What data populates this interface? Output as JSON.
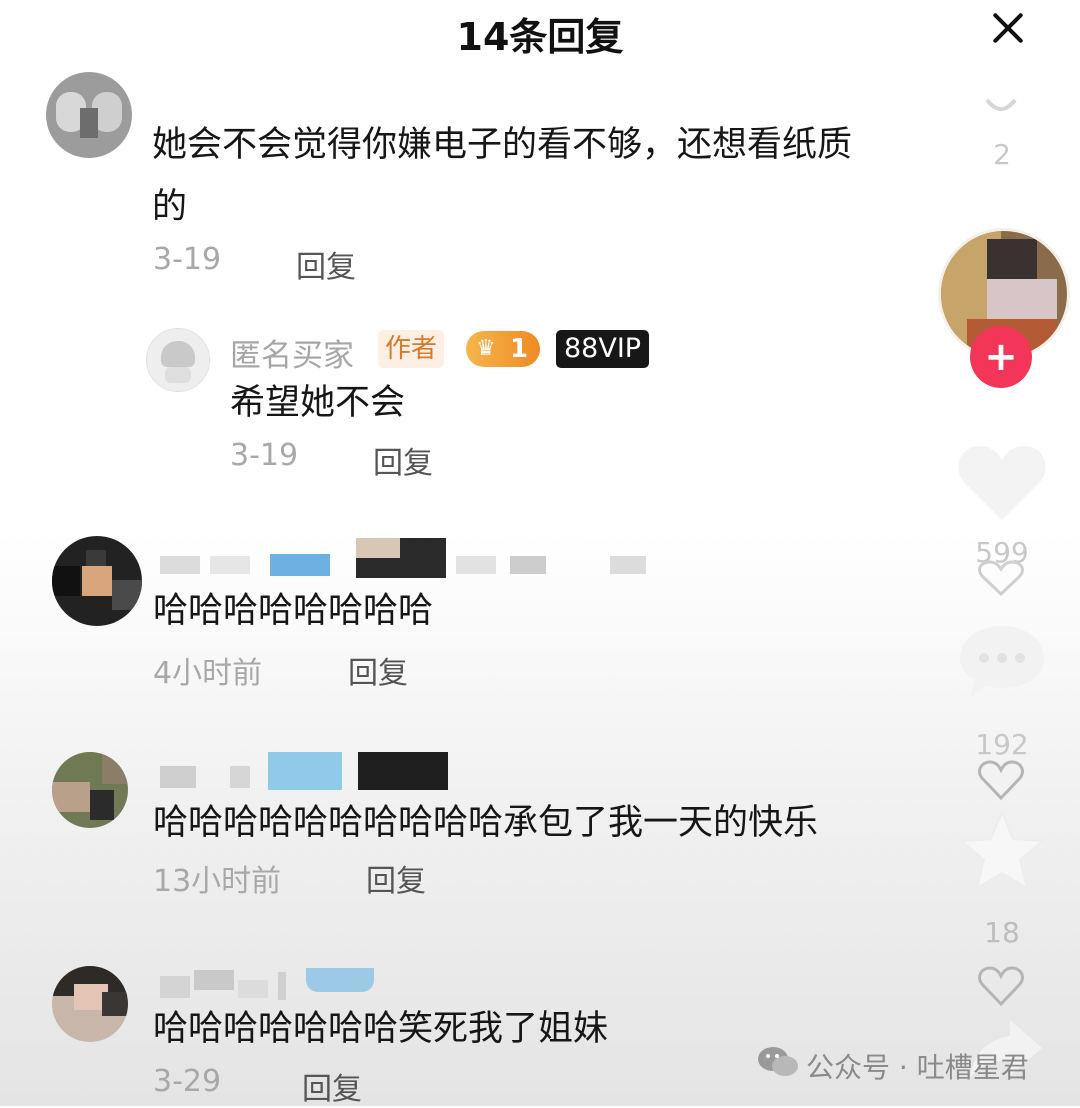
{
  "header": {
    "title": "14条回复"
  },
  "comments": [
    {
      "text_line1": "她会不会觉得你嫌电子的看不够，还想看纸质",
      "text_line2": "的",
      "date": "3-19",
      "reply_label": "回复"
    },
    {
      "name": "匿名买家",
      "author_badge": "作者",
      "level": "1",
      "vip_badge": "88VIP",
      "text": "希望她不会",
      "date": "3-19",
      "reply_label": "回复"
    },
    {
      "text": "哈哈哈哈哈哈哈哈",
      "date": "4小时前",
      "reply_label": "回复"
    },
    {
      "text": "哈哈哈哈哈哈哈哈哈哈承包了我一天的快乐",
      "date": "13小时前",
      "reply_label": "回复"
    },
    {
      "text": "哈哈哈哈哈哈哈笑死我了姐妹",
      "date": "3-29",
      "reply_label": "回复"
    }
  ],
  "sidebar": {
    "top_count": "2",
    "like_count": "599",
    "comment_count": "192",
    "star_count": "18"
  },
  "watermark": "公众号 · 吐槽星君",
  "icons": [
    "close-icon",
    "plus-icon",
    "heart-icon",
    "comment-icon",
    "star-icon",
    "share-icon",
    "wechat-icon",
    "crown-icon"
  ],
  "colors": {
    "plus_button": "#f4355a",
    "level_badge": "#f2a33a",
    "vip_badge": "#171717",
    "author_badge_text": "#d87a2c"
  }
}
